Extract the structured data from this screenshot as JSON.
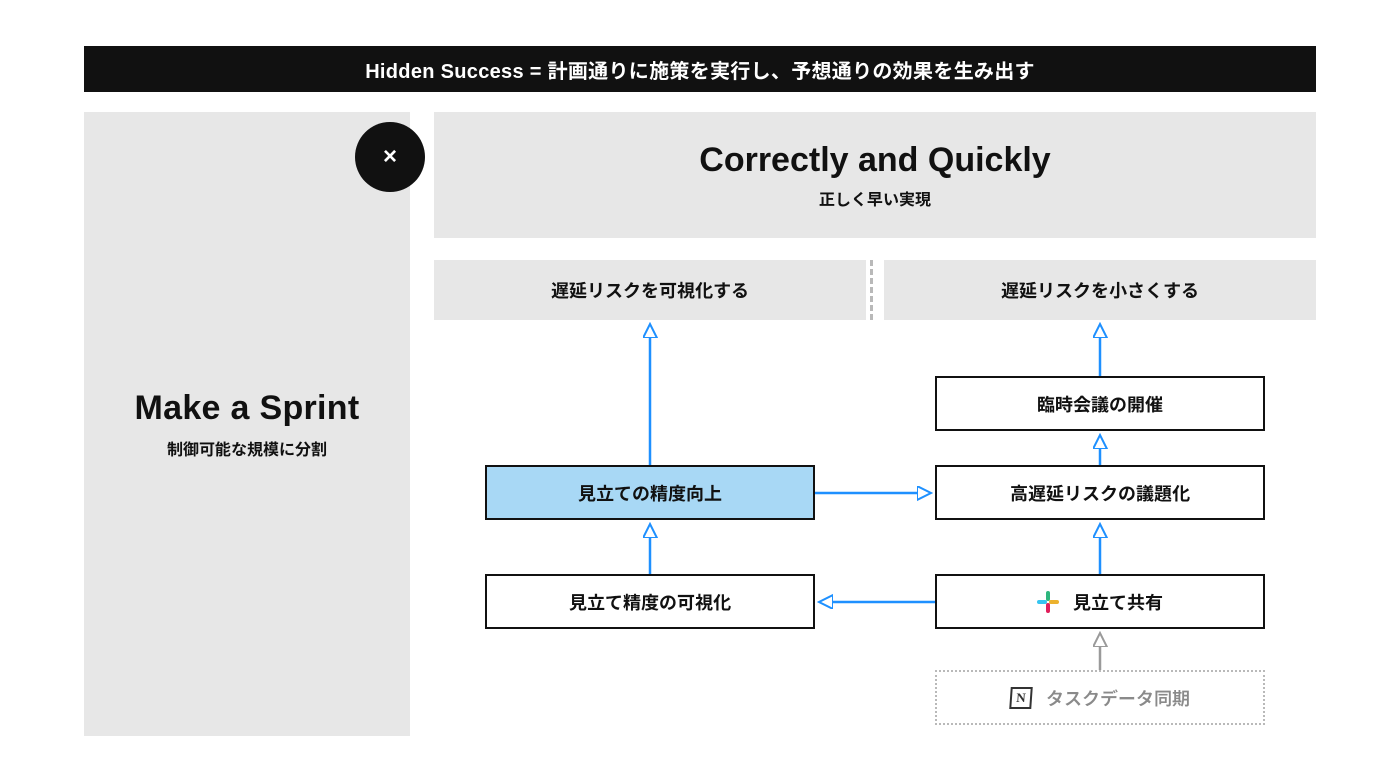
{
  "banner": {
    "text": "Hidden Success = 計画通りに施策を実行し、予想通りの効果を生み出す"
  },
  "left": {
    "title": "Make a Sprint",
    "subtitle": "制御可能な規模に分割"
  },
  "mult": {
    "glyph": "×"
  },
  "right_head": {
    "title": "Correctly and Quickly",
    "subtitle": "正しく早い実現"
  },
  "risk": {
    "left": "遅延リスクを可視化する",
    "right": "遅延リスクを小さくする"
  },
  "nodes": {
    "n1": "見立ての精度向上",
    "n2": "見立て精度の可視化",
    "n3": "臨時会議の開催",
    "n4": "高遅延リスクの議題化",
    "n5": "見立て共有",
    "n6": "タスクデータ同期"
  },
  "icons": {
    "notion_glyph": "N"
  },
  "colors": {
    "highlight": "#a8d8f5",
    "arrow_blue": "#1E90FF",
    "arrow_gray": "#9a9a9a"
  }
}
